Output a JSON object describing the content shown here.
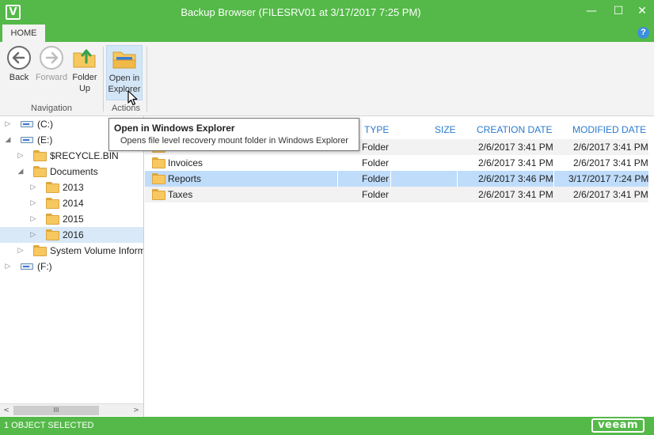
{
  "window": {
    "app_icon": "V",
    "title": "Backup Browser (FILESRV01 at 3/17/2017 7:25 PM)",
    "minimize_glyph": "—",
    "maximize_glyph": "☐",
    "close_glyph": "✕"
  },
  "ribbon": {
    "tab_home": "HOME",
    "help": "?",
    "navigation_group": "Navigation",
    "actions_group": "Actions",
    "back": "Back",
    "forward": "Forward",
    "folder_up_line1": "Folder",
    "folder_up_line2": "Up",
    "open_line1": "Open in",
    "open_line2": "Explorer"
  },
  "tooltip": {
    "title": "Open in Windows Explorer",
    "description": "Opens file level recovery mount folder in Windows Explorer"
  },
  "tree": {
    "items": [
      {
        "label": "(C:)",
        "type": "drive",
        "expander": "▷"
      },
      {
        "label": "(E:)",
        "type": "drive",
        "expander": "◢"
      },
      {
        "label": "$RECYCLE.BIN",
        "type": "folder",
        "expander": "▷"
      },
      {
        "label": "Documents",
        "type": "folder",
        "expander": "◢"
      },
      {
        "label": "2013",
        "type": "folder",
        "expander": "▷"
      },
      {
        "label": "2014",
        "type": "folder",
        "expander": "▷"
      },
      {
        "label": "2015",
        "type": "folder",
        "expander": "▷"
      },
      {
        "label": "2016",
        "type": "folder",
        "expander": "▷",
        "selected": true
      },
      {
        "label": "System Volume Inform",
        "type": "folder",
        "expander": "▷"
      },
      {
        "label": "(F:)",
        "type": "drive",
        "expander": "▷"
      }
    ],
    "scroll_left": "<",
    "scroll_right": ">",
    "scroll_thumb": "III"
  },
  "list": {
    "columns": {
      "type": "TYPE",
      "size": "SIZE",
      "created": "CREATION DATE",
      "modified": "MODIFIED DATE"
    },
    "rows": [
      {
        "name": "",
        "type": "Folder",
        "size": "",
        "created": "2/6/2017 3:41 PM",
        "modified": "2/6/2017 3:41 PM"
      },
      {
        "name": "Invoices",
        "type": "Folder",
        "size": "",
        "created": "2/6/2017 3:41 PM",
        "modified": "2/6/2017 3:41 PM"
      },
      {
        "name": "Reports",
        "type": "Folder",
        "size": "",
        "created": "2/6/2017 3:46 PM",
        "modified": "3/17/2017 7:24 PM",
        "selected": true
      },
      {
        "name": "Taxes",
        "type": "Folder",
        "size": "",
        "created": "2/6/2017 3:41 PM",
        "modified": "2/6/2017 3:41 PM"
      }
    ]
  },
  "status": {
    "text": "1 OBJECT SELECTED",
    "logo": "veeam"
  },
  "colors": {
    "accent_green": "#54b948",
    "selection_blue": "#bfdcfa",
    "header_blue": "#2a7ad0"
  }
}
